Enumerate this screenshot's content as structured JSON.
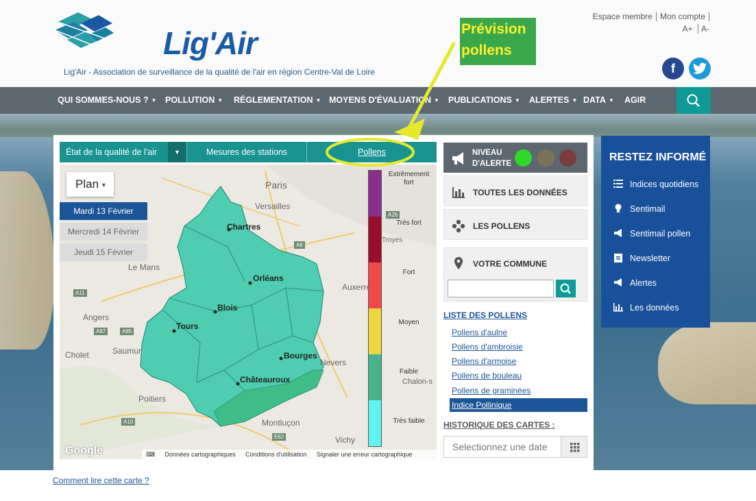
{
  "header": {
    "logo_text": "Lig'Air",
    "tagline": "Lig'Air - Association de surveillance de la qualité de l'air en région Centre-Val de Loire",
    "links": [
      "Espace membre",
      "Mon compte"
    ],
    "font_size_controls": [
      "A+",
      "A-"
    ],
    "callout": "Prévision pollens"
  },
  "nav": {
    "items": [
      "QUI SOMMES-NOUS ?",
      "POLLUTION",
      "RÉGLEMENTATION",
      "MOYENS D'ÉVALUATION",
      "PUBLICATIONS",
      "ALERTES",
      "DATA",
      "AGIR"
    ]
  },
  "tabs": {
    "quality": "État de la qualité de l'air",
    "stations": "Mesures des stations",
    "pollens": "Pollens"
  },
  "map": {
    "plan_button": "Plan",
    "days": [
      "Mardi 13 Février",
      "Mercredi 14 Février",
      "Jeudi 15 Février"
    ],
    "cities": [
      "Chartres",
      "Orléans",
      "Blois",
      "Tours",
      "Bourges",
      "Châteauroux"
    ],
    "towns": [
      "Paris",
      "Versailles",
      "Le Mans",
      "Angers",
      "Saumur",
      "Cholet",
      "Poitiers",
      "Auxerre",
      "Nevers",
      "Montluçon",
      "Vichy",
      "Chalon-s",
      "Troyes"
    ],
    "legend": [
      "Extrêmement fort",
      "Très fort",
      "Fort",
      "Moyen",
      "Faible",
      "Très faible"
    ],
    "legend_colors": [
      "#8a2d8f",
      "#9b0d2c",
      "#f04a48",
      "#efd540",
      "#46b38d",
      "#5ff2ee"
    ],
    "attribution": [
      "Données cartographiques",
      "Conditions d'utilisation",
      "Signaler une erreur cartographique"
    ],
    "google": "Google"
  },
  "alert": {
    "label_line1": "NIVEAU",
    "label_line2": "D'ALERTE",
    "colors": [
      "#30d82c",
      "#7a7357",
      "#7a3c3d"
    ]
  },
  "right": {
    "all_data": "TOUTES LES DONNÉES",
    "pollens": "LES POLLENS",
    "commune": "VOTRE COMMUNE",
    "pollen_list_title": "LISTE DES POLLENS",
    "pollen_list": [
      "Pollens d'aulne",
      "Pollens d'ambroisie",
      "Pollens d'armoise",
      "Pollens de bouleau",
      "Pollens de graminées"
    ],
    "pollen_active": "Indice Pollinique",
    "history_title": "HISTORIQUE DES CARTES :",
    "date_placeholder": "Selectionnez une date"
  },
  "restez": {
    "title": "RESTEZ INFORMÉ",
    "items": [
      "Indices quotidiens",
      "Sentimail",
      "Sentimail pollen",
      "Newsletter",
      "Alertes",
      "Les données"
    ]
  },
  "footer": {
    "link": "Comment lire cette carte ?"
  }
}
